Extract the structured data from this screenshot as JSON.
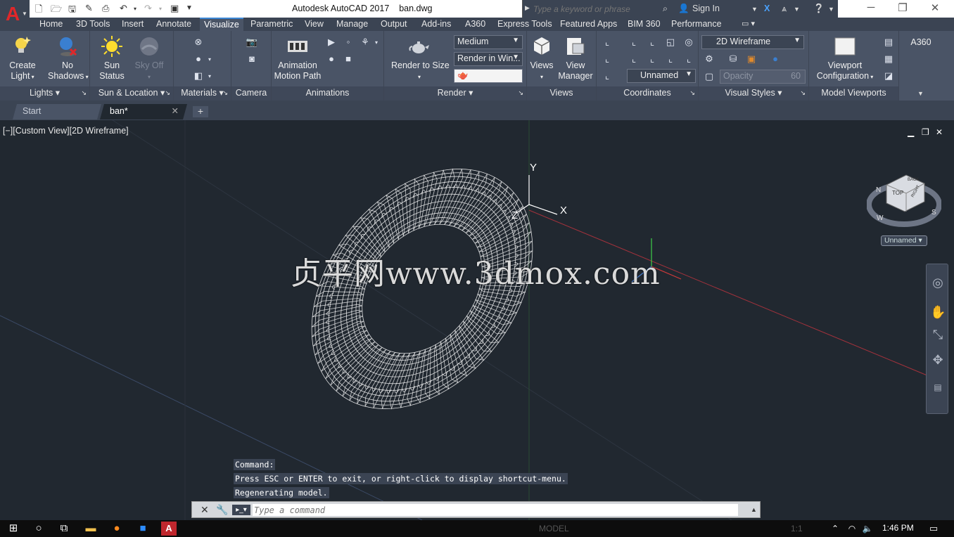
{
  "app": {
    "title": "Autodesk AutoCAD 2017",
    "file": "ban.dwg"
  },
  "search": {
    "placeholder": "Type a keyword or phrase"
  },
  "user": {
    "sign_in": "Sign In"
  },
  "ribbon_tabs": [
    "Home",
    "3D Tools",
    "Insert",
    "Annotate",
    "Visualize",
    "Parametric",
    "View",
    "Manage",
    "Output",
    "Add-ins",
    "A360",
    "Express Tools",
    "Featured Apps",
    "BIM 360",
    "Performance"
  ],
  "active_tab": "Visualize",
  "panels": {
    "lights": {
      "title": "Lights",
      "create_light": [
        "Create",
        "Light"
      ],
      "no_shadows": [
        "No",
        "Shadows"
      ]
    },
    "sun": {
      "title": "Sun & Location",
      "sun_status": [
        "Sun",
        "Status"
      ],
      "sky_off": "Sky Off"
    },
    "materials": {
      "title": "Materials"
    },
    "camera": {
      "title": "Camera"
    },
    "animations": {
      "title": "Animations",
      "motion_path": [
        "Animation",
        "Motion Path"
      ]
    },
    "render": {
      "title": "Render",
      "render_to_size": "Render to Size",
      "quality": "Medium",
      "render_in": "Render in Win..."
    },
    "views": {
      "title": "Views",
      "views": "Views",
      "view_manager": [
        "View",
        "Manager"
      ]
    },
    "coordinates": {
      "title": "Coordinates",
      "ucs": "Unnamed"
    },
    "visual_styles": {
      "title": "Visual Styles",
      "style": "2D Wireframe",
      "opacity_label": "Opacity",
      "opacity_value": "60"
    },
    "model_viewports": {
      "title": "Model Viewports",
      "viewport_config": [
        "Viewport",
        "Configuration"
      ]
    },
    "a360": {
      "title": "A360"
    }
  },
  "file_tabs": {
    "start": "Start",
    "current": "ban*"
  },
  "viewport": {
    "label": "[−][Custom View][2D Wireframe]",
    "watermark": "贞平网www.3dmox.com",
    "ucs_name": "Unnamed",
    "axis_x": "X",
    "axis_y": "Y",
    "axis_z": "Z",
    "cube_top": "TOP",
    "cube_back": "BACK",
    "cube_right": "RIGHT",
    "compass": {
      "n": "N",
      "w": "W",
      "s": "S"
    }
  },
  "command": {
    "history": [
      "Command:",
      "Press ESC or ENTER to exit, or right-click to display shortcut-menu.",
      "Regenerating model."
    ],
    "placeholder": "Type a command"
  },
  "status": {
    "model": "MODEL",
    "scale": "1:1"
  },
  "taskbar": {
    "time": "1:46 PM"
  },
  "colors": {
    "accent": "#3b86d4",
    "ribbon_bg": "#4a5466",
    "viewport_bg": "#212830",
    "wire": "#ffffff"
  }
}
